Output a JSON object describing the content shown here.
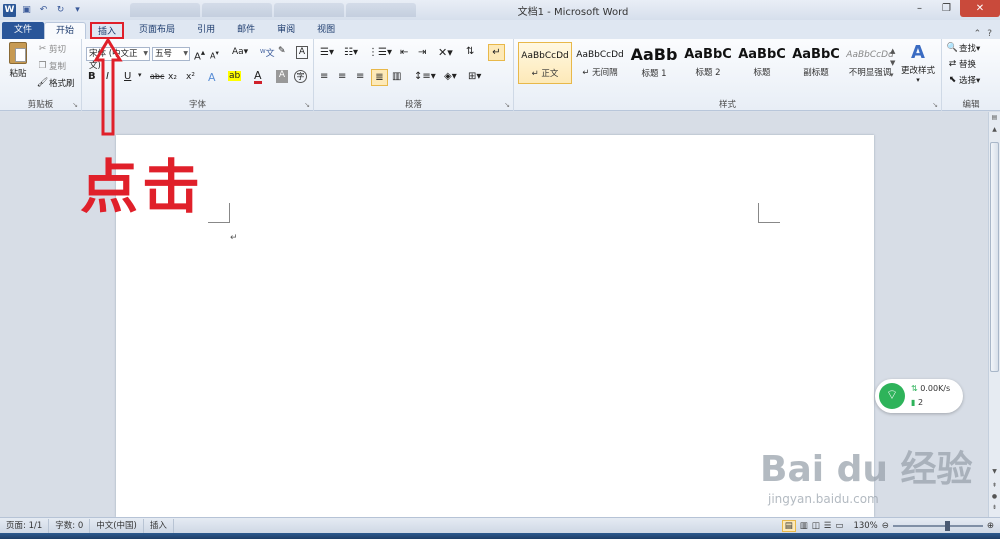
{
  "titlebar": {
    "title": "文档1 - Microsoft Word",
    "qat_icons": [
      "word-logo-icon",
      "save-icon",
      "undo-icon",
      "redo-icon",
      "customize-qat-icon"
    ],
    "window_buttons": {
      "minimize": "–",
      "restore": "❐",
      "close": "✕"
    }
  },
  "tabs": {
    "file": "文件",
    "home": "开始",
    "insert": "插入",
    "page_layout": "页面布局",
    "references": "引用",
    "mailings": "邮件",
    "review": "审阅",
    "view": "视图"
  },
  "ribbon": {
    "clipboard": {
      "label": "剪贴板",
      "paste": "粘贴",
      "cut": "剪切",
      "copy": "复制",
      "format_painter": "格式刷"
    },
    "font": {
      "label": "字体",
      "font_name": "宋体 (中文正文)",
      "font_size": "五号",
      "bold": "B",
      "italic": "I",
      "underline": "U",
      "strikethrough": "abc",
      "subscript": "x₂",
      "superscript": "x²",
      "change_case": "Aa",
      "grow": "A",
      "shrink": "A"
    },
    "paragraph": {
      "label": "段落"
    },
    "styles": {
      "label": "样式",
      "items": [
        {
          "sample": "AaBbCcDd",
          "name": "↵ 正文"
        },
        {
          "sample": "AaBbCcDd",
          "name": "↵ 无间隔"
        },
        {
          "sample": "AaBb",
          "name": "标题 1"
        },
        {
          "sample": "AaBbC",
          "name": "标题 2"
        },
        {
          "sample": "AaBbC",
          "name": "标题"
        },
        {
          "sample": "AaBbC",
          "name": "副标题"
        },
        {
          "sample": "AaBbCcDd",
          "name": "不明显强调"
        }
      ],
      "change_styles": "更改样式"
    },
    "editing": {
      "label": "编辑",
      "find": "查找",
      "replace": "替换",
      "select": "选择"
    }
  },
  "document": {
    "paragraph_mark": "↵"
  },
  "annotation": {
    "text": "点击"
  },
  "network_widget": {
    "speed": "0.00K/s",
    "count": "2"
  },
  "watermark": {
    "brand": "Bai du 经验",
    "url": "jingyan.baidu.com"
  },
  "statusbar": {
    "page": "页面: 1/1",
    "words": "字数: 0",
    "language": "中文(中国)",
    "mode": "插入",
    "zoom": "130%"
  },
  "colors": {
    "file_tab": "#2a5699",
    "annotation_red": "#e0202a",
    "wifi_green": "#2eb35a"
  }
}
